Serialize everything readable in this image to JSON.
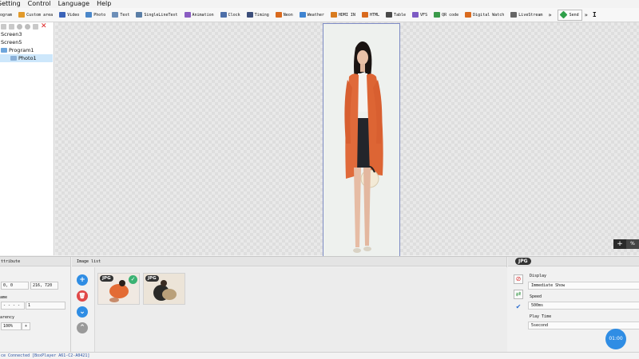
{
  "menu": [
    "Setting",
    "Control",
    "Language",
    "Help"
  ],
  "toolbar": {
    "program": "ogram",
    "items": [
      {
        "label": "Custom area",
        "icon": "custom-area-icon",
        "color": "#e29a2a"
      },
      {
        "label": "Video",
        "icon": "video-icon",
        "color": "#3a63b8"
      },
      {
        "label": "Photo",
        "icon": "photo-icon",
        "color": "#4a87c9"
      },
      {
        "label": "Text",
        "icon": "text-icon",
        "color": "#6d8fb8"
      },
      {
        "label": "SingleLineText",
        "icon": "single-line-text-icon",
        "color": "#5a7ea6"
      },
      {
        "label": "Animation",
        "icon": "animation-icon",
        "color": "#8a5cc2"
      },
      {
        "label": "Clock",
        "icon": "clock-icon",
        "color": "#4d6fa8"
      },
      {
        "label": "Timing",
        "icon": "timing-icon",
        "color": "#3c4e7a"
      },
      {
        "label": "Neon",
        "icon": "neon-icon",
        "color": "#d96a1e"
      },
      {
        "label": "Weather",
        "icon": "weather-icon",
        "color": "#3f84d1"
      },
      {
        "label": "HDMI IN",
        "icon": "hdmi-in-icon",
        "color": "#d97b1e"
      },
      {
        "label": "HTML",
        "icon": "html-icon",
        "color": "#d96a1e"
      },
      {
        "label": "Table",
        "icon": "table-icon",
        "color": "#4a4a4a"
      },
      {
        "label": "VFS",
        "icon": "vfs-icon",
        "color": "#7d5bc4"
      },
      {
        "label": "QR code",
        "icon": "qr-code-icon",
        "color": "#3a9a4a"
      },
      {
        "label": "Digital Watch",
        "icon": "digital-watch-icon",
        "color": "#d96a1e"
      },
      {
        "label": "LiveStream",
        "icon": "livestream-icon",
        "color": "#666666"
      }
    ],
    "more": "»",
    "send": "Send",
    "more2": "»",
    "extra": "I"
  },
  "tree": {
    "nodes": [
      {
        "label": "Screen3"
      },
      {
        "label": "Screen5"
      },
      {
        "label": "Program1"
      },
      {
        "label": "Photo1"
      }
    ]
  },
  "canvas": {
    "zoom_plus": "+",
    "zoom_extra": "%"
  },
  "attributes": {
    "title": "ttribute",
    "pos_value": "0, 0",
    "size_value": "216, 720",
    "effect_label": "ame",
    "effect_value": "- - - -",
    "effect_num": "1",
    "opacity_label": "arency",
    "opacity_value": "100%",
    "plus": "+"
  },
  "image_list": {
    "title": "Image list",
    "add": "+",
    "delete": "🗑",
    "down": "⌄",
    "up": "⌃",
    "thumbs": [
      {
        "badge": "JPG",
        "checked": true
      },
      {
        "badge": "JPG",
        "checked": false
      }
    ],
    "check": "✓"
  },
  "properties": {
    "badge": "JPG",
    "display_label": "Display",
    "display_value": "Immediate Show",
    "speed_label": "Speed",
    "speed_value": "500ms",
    "play_label": "Play Time",
    "play_value": "5second",
    "timer": "01:00"
  },
  "status": "ce Connected [BoxPlayer A61-C2-A0421]",
  "colors": {
    "accent": "#2f8de4",
    "selection": "#cde7fb",
    "screen_border": "#7d8bc4",
    "coat": "#e06a3a"
  }
}
